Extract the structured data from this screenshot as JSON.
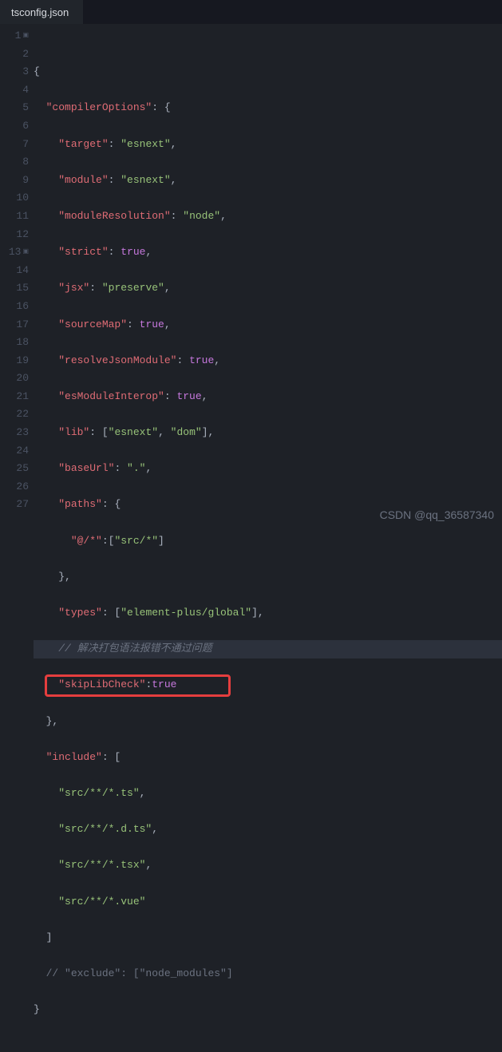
{
  "tab": {
    "filename": "tsconfig.json"
  },
  "gutter": {
    "start": 1,
    "end": 27,
    "fold_lines": [
      1,
      13
    ]
  },
  "highlight": {
    "line": 18
  },
  "tokens": {
    "brace_open": "{",
    "brace_close": "}",
    "bracket_open": "[",
    "bracket_close": "]",
    "comma": ",",
    "colon": ":",
    "compilerOptions": "\"compilerOptions\"",
    "target": "\"target\"",
    "target_v": "\"esnext\"",
    "module": "\"module\"",
    "module_v": "\"esnext\"",
    "moduleResolution": "\"moduleResolution\"",
    "moduleResolution_v": "\"node\"",
    "strict": "\"strict\"",
    "true": "true",
    "jsx": "\"jsx\"",
    "jsx_v": "\"preserve\"",
    "sourceMap": "\"sourceMap\"",
    "resolveJsonModule": "\"resolveJsonModule\"",
    "esModuleInterop": "\"esModuleInterop\"",
    "lib": "\"lib\"",
    "lib_v1": "\"esnext\"",
    "lib_v2": "\"dom\"",
    "baseUrl": "\"baseUrl\"",
    "baseUrl_v": "\".\"",
    "paths": "\"paths\"",
    "paths_key": "\"@/*\"",
    "paths_val": "\"src/*\"",
    "types": "\"types\"",
    "types_v": "\"element-plus/global\"",
    "comment_cn": "// 解决打包语法报错不通过问题",
    "skipLibCheck": "\"skipLibCheck\"",
    "include": "\"include\"",
    "include_v1": "\"src/**/*.ts\"",
    "include_v2": "\"src/**/*.d.ts\"",
    "include_v3": "\"src/**/*.tsx\"",
    "include_v4": "\"src/**/*.vue\"",
    "exclude_comment": "// \"exclude\": [\"node_modules\"]"
  },
  "watermark": "CSDN @qq_36587340"
}
